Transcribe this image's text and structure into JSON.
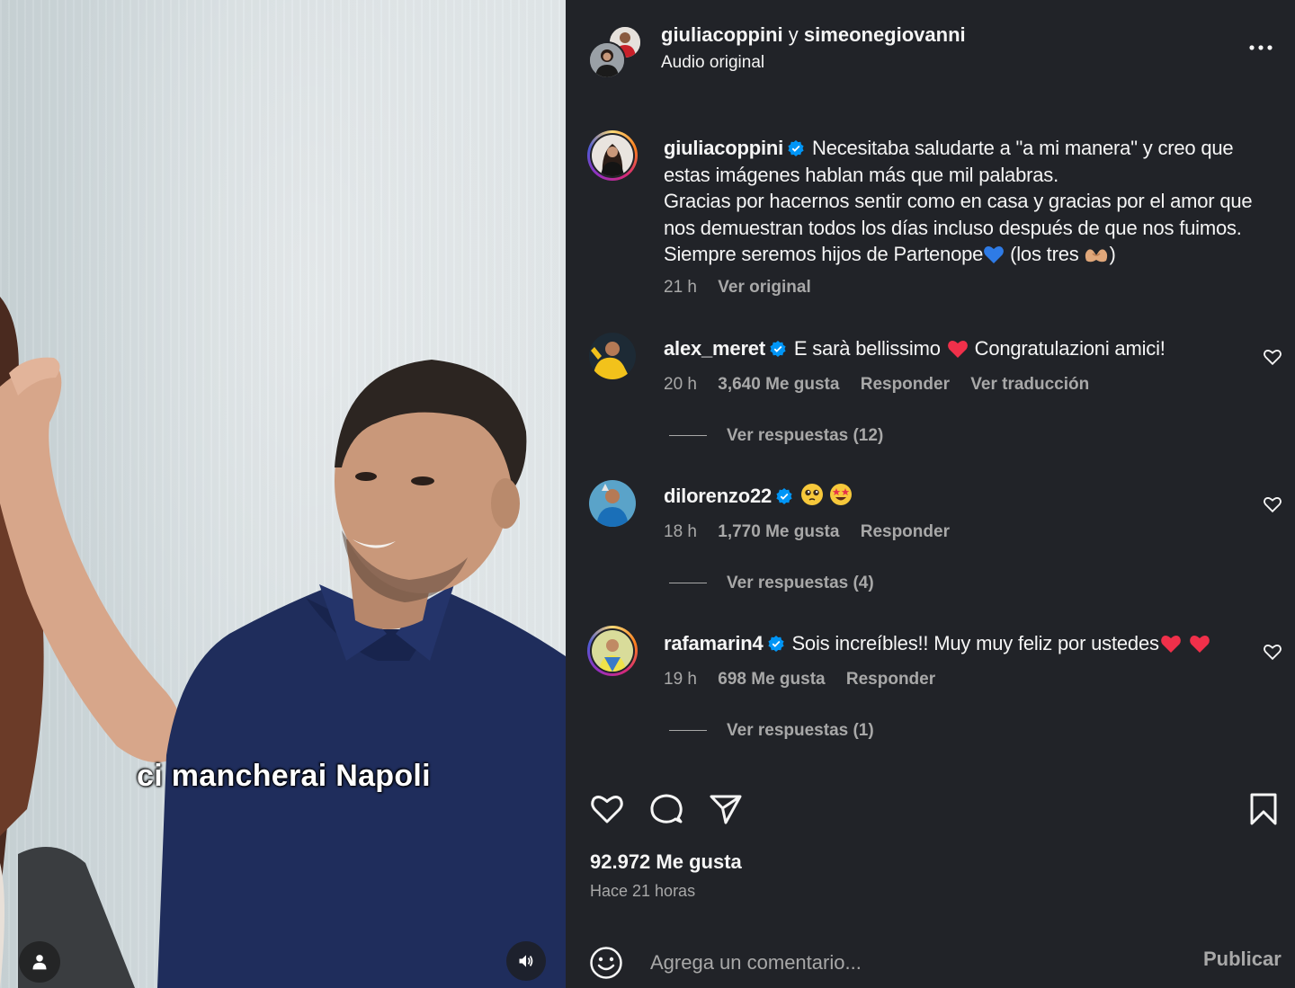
{
  "video": {
    "caption": "ci mancherai Napoli",
    "user_icon": "user-icon",
    "sound_icon": "speaker-on-icon"
  },
  "header": {
    "user1": "giuliacoppini",
    "conjunction": "y",
    "user2": "simeonegiovanni",
    "audio": "Audio original",
    "more_icon": "more-horizontal-icon"
  },
  "post": {
    "username": "giuliacoppini",
    "text_line1": "Necesitaba saludarte a \"a mi manera\" y creo que estas imágenes hablan más que mil palabras.",
    "text_line2": "Gracias por hacernos sentir como en casa y gracias por el amor que nos demuestran todos los días incluso después de que nos fuimos.",
    "text_line3a": "Siempre seremos hijos de Partenope",
    "text_line3b": "(los tres",
    "text_line3c": ")",
    "time": "21 h",
    "see_original": "Ver original"
  },
  "comments": [
    {
      "username": "alex_meret",
      "text_a": "E sarà bellissimo",
      "text_b": "Congratulazioni amici!",
      "time": "20 h",
      "likes": "3,640 Me gusta",
      "reply": "Responder",
      "translate": "Ver traducción",
      "replies": "Ver respuestas (12)"
    },
    {
      "username": "dilorenzo22",
      "time": "18 h",
      "likes": "1,770 Me gusta",
      "reply": "Responder",
      "replies": "Ver respuestas (4)"
    },
    {
      "username": "rafamarin4",
      "text_a": "Sois increíbles!! Muy muy feliz por ustedes",
      "time": "19 h",
      "likes": "698 Me gusta",
      "reply": "Responder",
      "replies": "Ver respuestas (1)"
    }
  ],
  "footer": {
    "likes": "92.972 Me gusta",
    "ago": "Hace 21 horas",
    "comment_placeholder": "Agrega un comentario...",
    "publish": "Publicar"
  },
  "colors": {
    "panel_bg": "#212328",
    "text": "#f5f5f5",
    "secondary": "#a8a8a8",
    "verified": "#0095f6",
    "heart_red": "#ed4956"
  }
}
